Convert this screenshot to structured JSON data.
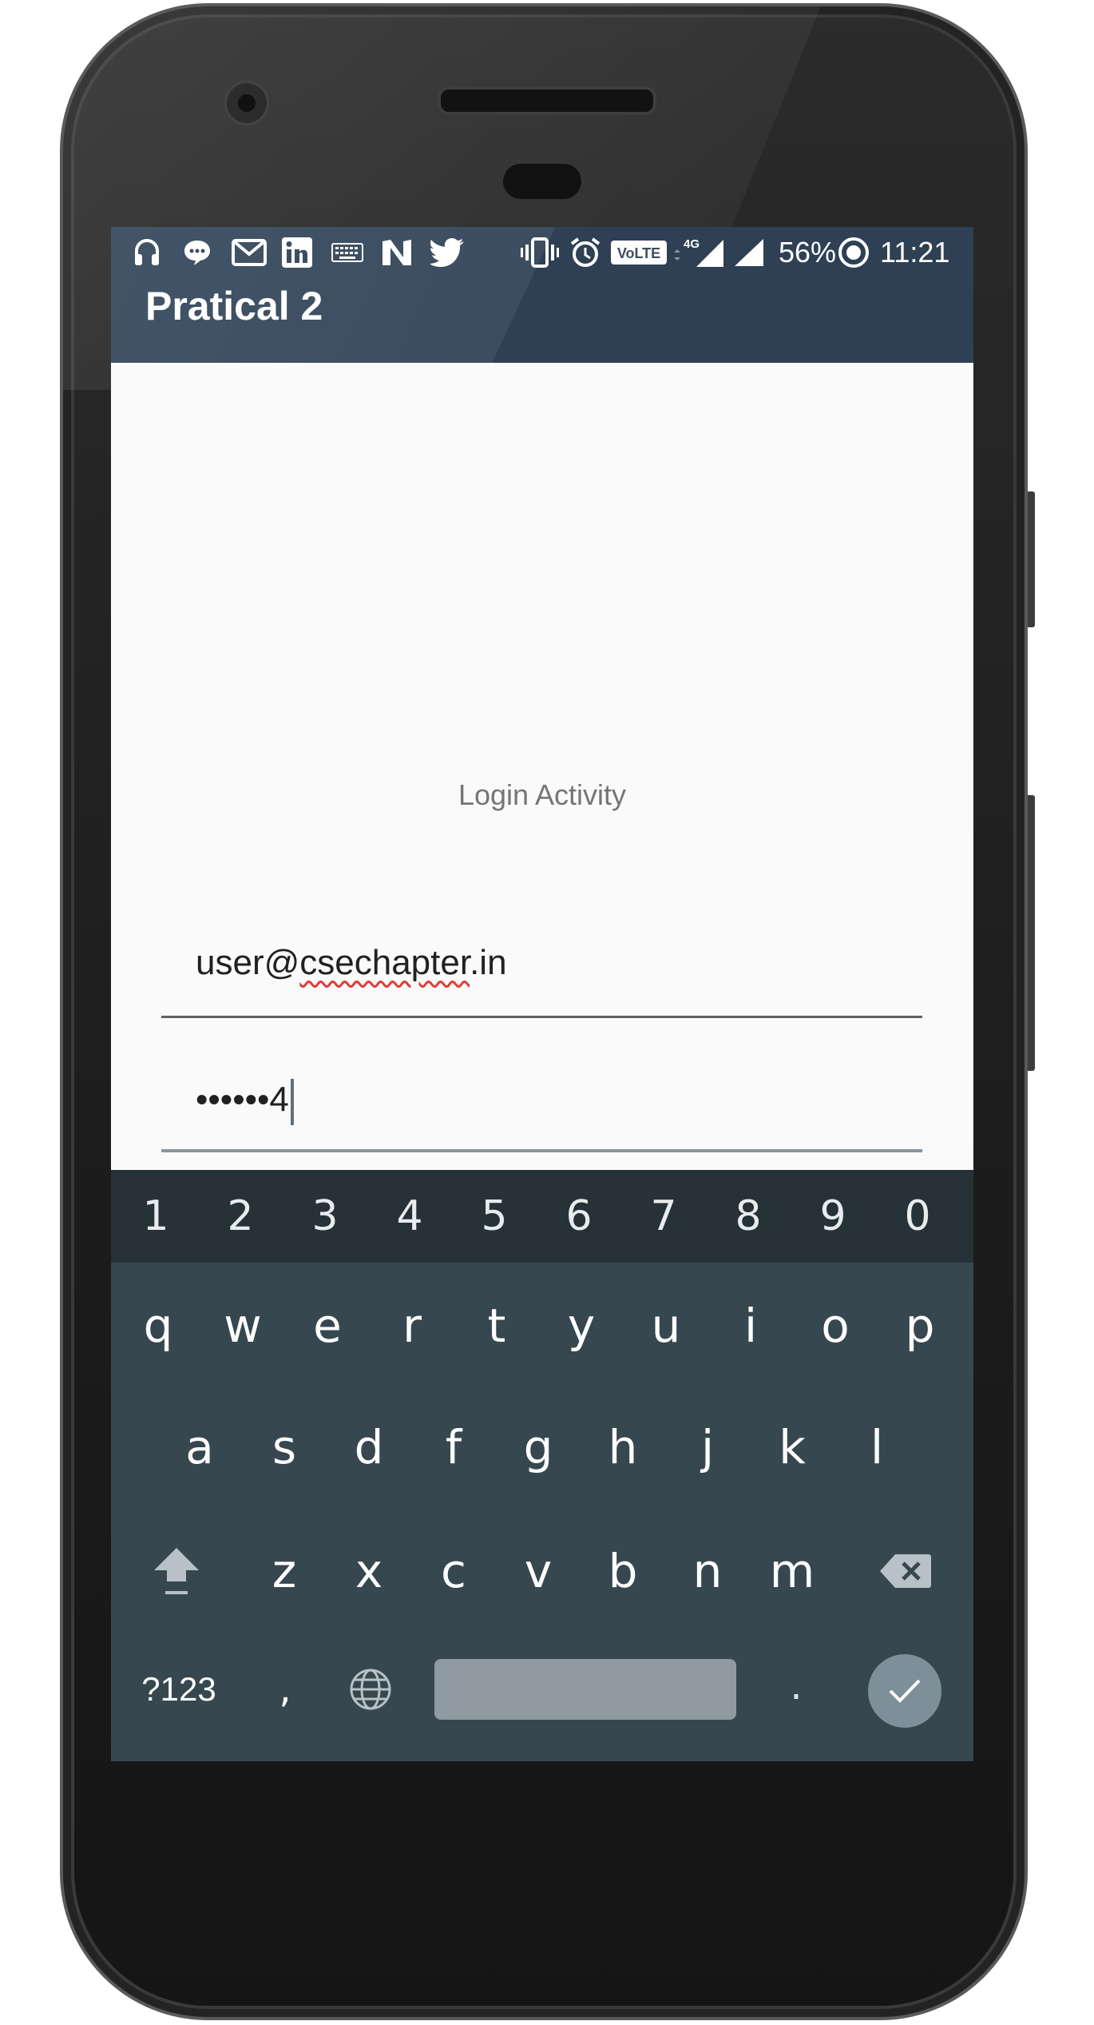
{
  "statusbar": {
    "battery": "56%",
    "time": "11:21",
    "network": "4G",
    "volte": "VoLTE",
    "icons": [
      "headphones-icon",
      "chat-icon",
      "gmail-icon",
      "linkedin-icon",
      "keyboard-icon",
      "n-icon",
      "twitter-icon",
      "vibrate-icon",
      "alarm-icon",
      "volte-icon",
      "signal-4g-icon",
      "signal-icon",
      "battery-icon"
    ]
  },
  "appbar": {
    "title": "Pratical 2"
  },
  "main": {
    "label": "Login Activity",
    "email_prefix": "user@",
    "email_underlined": "csechapter",
    "email_suffix": ".in",
    "password_value": "••••••4"
  },
  "keyboard": {
    "numbers": [
      "1",
      "2",
      "3",
      "4",
      "5",
      "6",
      "7",
      "8",
      "9",
      "0"
    ],
    "row1": [
      "q",
      "w",
      "e",
      "r",
      "t",
      "y",
      "u",
      "i",
      "o",
      "p"
    ],
    "row2": [
      "a",
      "s",
      "d",
      "f",
      "g",
      "h",
      "j",
      "k",
      "l"
    ],
    "row3": [
      "z",
      "x",
      "c",
      "v",
      "b",
      "n",
      "m"
    ],
    "sym_label": "?123",
    "comma": ",",
    "period": "."
  }
}
